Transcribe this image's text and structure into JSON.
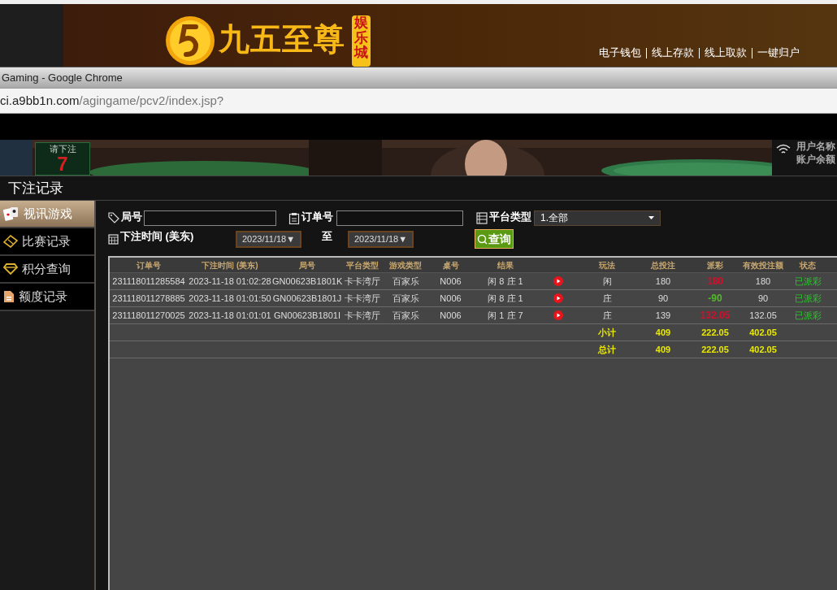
{
  "banner": {
    "logo_text": "九五至尊",
    "badge": "娱乐城",
    "links": [
      "电子钱包",
      "线上存款",
      "线上取款",
      "一键归户"
    ]
  },
  "browser": {
    "title": "Gaming - Google Chrome",
    "url_host": "ci.a9bb1n.com",
    "url_path": "/agingame/pcv2/index.jsp?"
  },
  "game_strip": {
    "kind": "picture",
    "prompt": "请下注",
    "countdown": "7",
    "info_labels": [
      "用户名称",
      "账户余额"
    ]
  },
  "page_title": "下注记录",
  "sidebar": {
    "items": [
      {
        "label": "视讯游戏",
        "selected": true
      },
      {
        "label": "比赛记录",
        "selected": false
      },
      {
        "label": "积分查询",
        "selected": false
      },
      {
        "label": "额度记录",
        "selected": false
      }
    ]
  },
  "filters": {
    "round_label": "局号",
    "order_label": "订单号",
    "platform_label": "平台类型",
    "platform_value": "1.全部",
    "time_label": "下注时间 (美东)",
    "date_from": "2023/11/18▼",
    "to_label": "至",
    "date_to": "2023/11/18▼",
    "query_button": "查询"
  },
  "table": {
    "columns": [
      "订单号",
      "下注时间 (美东)",
      "局号",
      "平台类型",
      "游戏类型",
      "桌号",
      "结果",
      "玩法",
      "总投注",
      "派彩",
      "有效投注额",
      "状态"
    ],
    "rows": [
      {
        "kind": "bet",
        "order": "231118011285584",
        "time": "2023-11-18 01:02:28",
        "round": "GN00623B1801K",
        "platform": "卡卡湾厅",
        "game": "百家乐",
        "table": "N006",
        "result": "闲 8 庄 1",
        "play": "闲",
        "stake": "180",
        "payout": "180",
        "color": "#d0102c",
        "valid": "180",
        "status": "已派彩"
      },
      {
        "kind": "bet",
        "order": "231118011278885",
        "time": "2023-11-18 01:01:50",
        "round": "GN00623B1801J",
        "platform": "卡卡湾厅",
        "game": "百家乐",
        "table": "N006",
        "result": "闲 8 庄 1",
        "play": "庄",
        "stake": "90",
        "payout": "-90",
        "color": "#52b82a",
        "valid": "90",
        "status": "已派彩"
      },
      {
        "kind": "bet",
        "order": "231118011270025",
        "time": "2023-11-18 01:01:01",
        "round": "GN00623B1801I",
        "platform": "卡卡湾厅",
        "game": "百家乐",
        "table": "N006",
        "result": "闲 1 庄 7",
        "play": "庄",
        "stake": "139",
        "payout": "132.05",
        "color": "#d0102c",
        "valid": "132.05",
        "status": "已派彩"
      },
      {
        "kind": "total",
        "label": "小计",
        "stake": "409",
        "payout": "222.05",
        "valid": "402.05"
      },
      {
        "kind": "total",
        "label": "总计",
        "stake": "409",
        "payout": "222.05",
        "valid": "402.05"
      }
    ]
  }
}
